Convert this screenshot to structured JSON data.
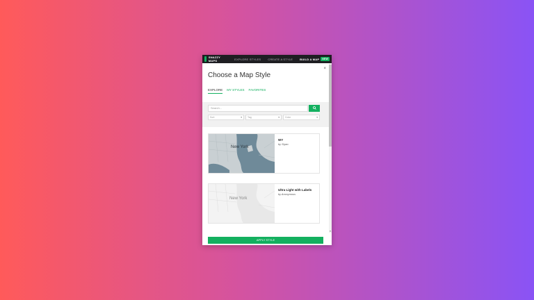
{
  "nav": {
    "logo": "SNAZZY MAPS",
    "links": [
      "EXPLORE STYLES",
      "CREATE A STYLE"
    ],
    "build": "BUILD A MAP",
    "badge": "NEW"
  },
  "dialog": {
    "title": "Choose a Map Style",
    "close": "×",
    "tabs": [
      {
        "label": "EXPLORE",
        "active": true
      },
      {
        "label": "MY STYLES",
        "active": false
      },
      {
        "label": "FAVORITES",
        "active": false
      }
    ]
  },
  "filters": {
    "search_placeholder": "Search...",
    "search_icon": "search-icon",
    "sort_label": "Sort",
    "tag_label": "Tag",
    "color_label": "Color"
  },
  "styles": [
    {
      "name": "WY",
      "author": "by Siyao",
      "map": {
        "city": "New York",
        "palette": {
          "water": "#6f8a99",
          "land": "#c9d0d3",
          "roads": "#b4bec2"
        }
      }
    },
    {
      "name": "Ultra Light with Labels",
      "author": "by Anonymous",
      "map": {
        "city": "New York",
        "palette": {
          "water": "#e8e8e8",
          "land": "#f3f3f3",
          "roads": "#dddddd"
        }
      }
    }
  ],
  "apply_label": "APPLY STYLE",
  "colors": {
    "accent": "#13b05f",
    "nav_bg": "#1e1e22"
  }
}
